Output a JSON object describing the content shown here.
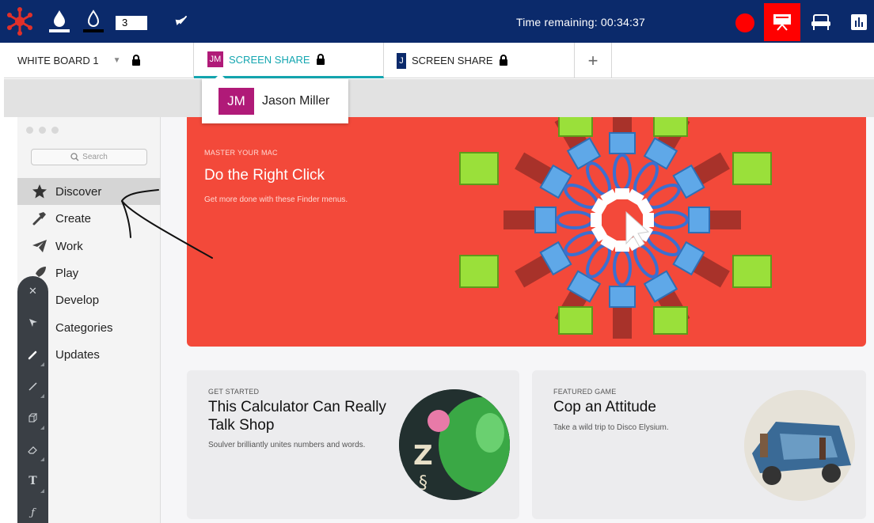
{
  "topbar": {
    "page_number": "3",
    "timer": "Time remaining: 00:34:37",
    "colors": {
      "bar": "#0b2a6b",
      "record": "#ff0000",
      "active": "#ff0000"
    }
  },
  "tabs": [
    {
      "label": "WHITE BOARD 1",
      "locked": true
    },
    {
      "label": "SCREEN SHARE",
      "initials": "JM",
      "avatar_color": "#b01a78",
      "locked": true,
      "active": true
    },
    {
      "label": "SCREEN SHARE",
      "initials": "J",
      "avatar_color": "#0b2a6b",
      "locked": true
    }
  ],
  "add_tab_label": "+",
  "popup": {
    "initials": "JM",
    "name": "Jason Miller"
  },
  "mac": {
    "search_placeholder": "Search",
    "nav": [
      {
        "label": "Discover",
        "icon": "star-icon",
        "selected": true
      },
      {
        "label": "Create",
        "icon": "hammer-icon"
      },
      {
        "label": "Work",
        "icon": "paper-plane-icon"
      },
      {
        "label": "Play",
        "icon": "rocket-icon"
      },
      {
        "label": "Develop",
        "icon": "code-icon"
      },
      {
        "label": "Categories",
        "icon": "grid-icon"
      },
      {
        "label": "Updates",
        "icon": "download-icon"
      }
    ],
    "hero": {
      "eyebrow": "MASTER YOUR MAC",
      "title": "Do the Right Click",
      "subtitle": "Get more done with these Finder menus."
    },
    "card1": {
      "eyebrow": "GET STARTED",
      "title_line1": "This Calculator Can Really",
      "title_line2": "Talk Shop",
      "subtitle": "Soulver brilliantly unites numbers and words."
    },
    "card2": {
      "eyebrow": "FEATURED GAME",
      "title": "Cop an Attitude",
      "subtitle": "Take a wild trip to Disco Elysium."
    }
  },
  "drawing_tools": [
    "close-icon",
    "pointer-icon",
    "pen-icon",
    "line-icon",
    "shape-icon",
    "eraser-icon",
    "text-icon",
    "formula-icon"
  ]
}
